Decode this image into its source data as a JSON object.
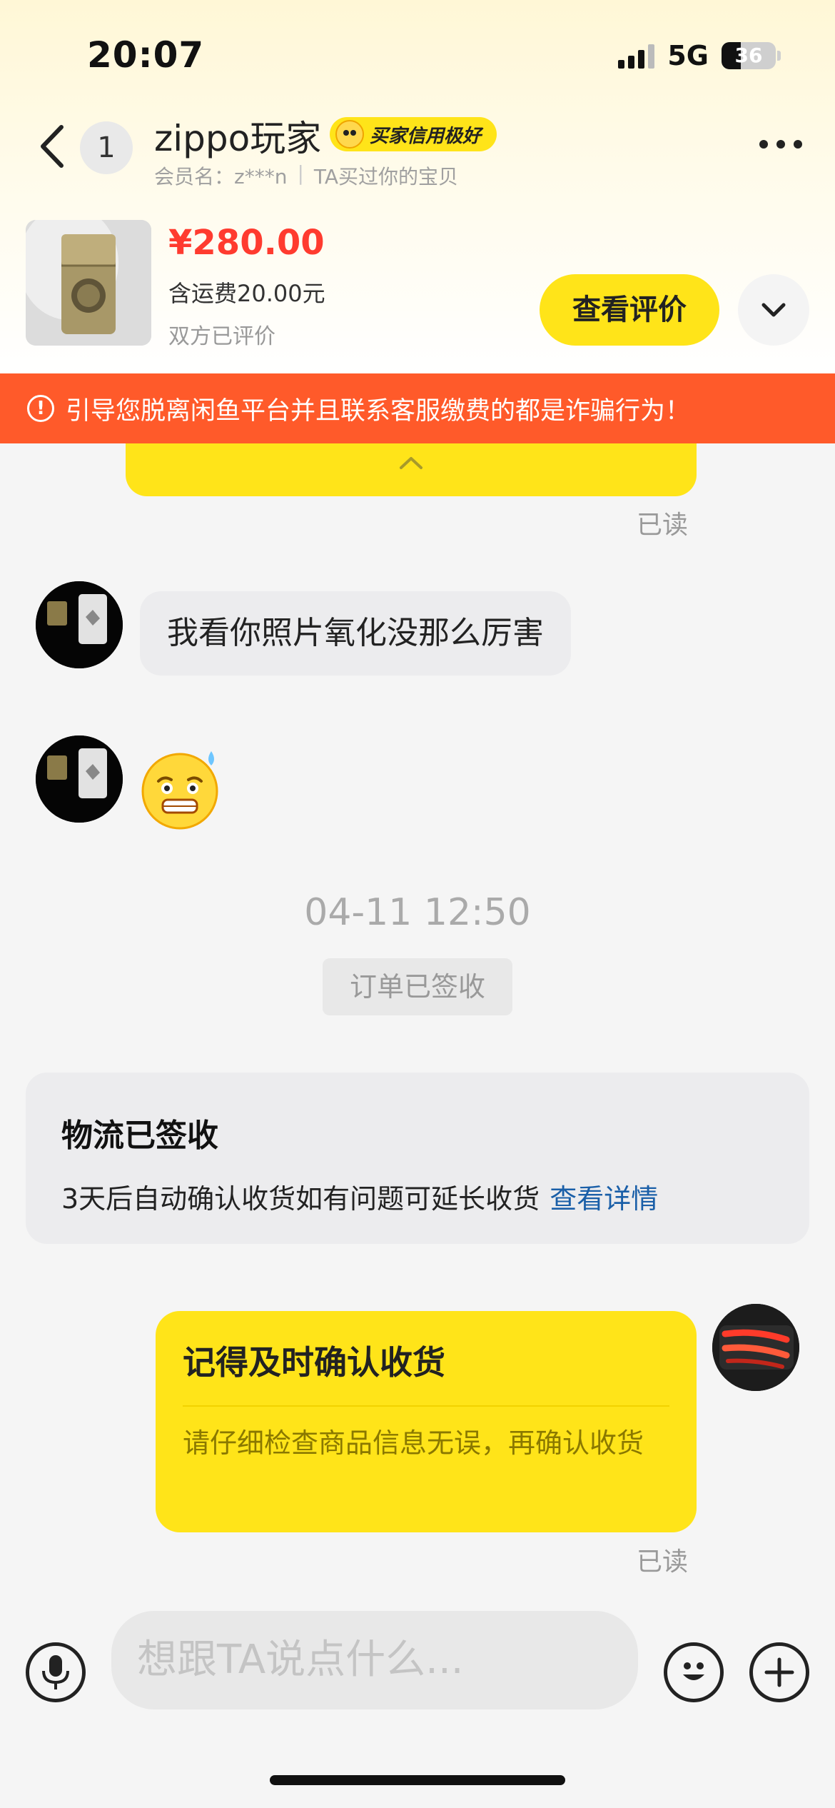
{
  "status_bar": {
    "time": "20:07",
    "network": "5G",
    "battery": "36",
    "battery_level": 0.36
  },
  "header": {
    "unread_count": "1",
    "nickname": "zippo玩家",
    "credit_badge": "买家信用极好",
    "member_label": "会员名：z***n",
    "relation": "TA买过你的宝贝"
  },
  "item": {
    "price": "¥280.00",
    "shipping": "含运费20.00元",
    "eval_status": "双方已评价",
    "review_button": "查看评价"
  },
  "warning": {
    "text": "引导您脱离闲鱼平台并且联系客服缴费的都是诈骗行为！"
  },
  "messages": {
    "read_label": "已读",
    "incoming_text": "我看你照片氧化没那么厉害",
    "incoming_emoji": "sweat-grin-emoji",
    "timestamp": "04-11 12:50",
    "system_tag": "订单已签收",
    "logistics": {
      "title": "物流已签收",
      "text": "3天后自动确认收货如有问题可延长收货",
      "link": "查看详情"
    },
    "reminder": {
      "title": "记得及时确认收货",
      "body": "请仔细检查商品信息无误，再确认收货"
    }
  },
  "input": {
    "placeholder": "想跟TA说点什么..."
  },
  "colors": {
    "accent_yellow": "#ffe419",
    "price_red": "#ff3b2f",
    "warning_orange": "#ff5a2a",
    "link_blue": "#1a5fa8"
  }
}
